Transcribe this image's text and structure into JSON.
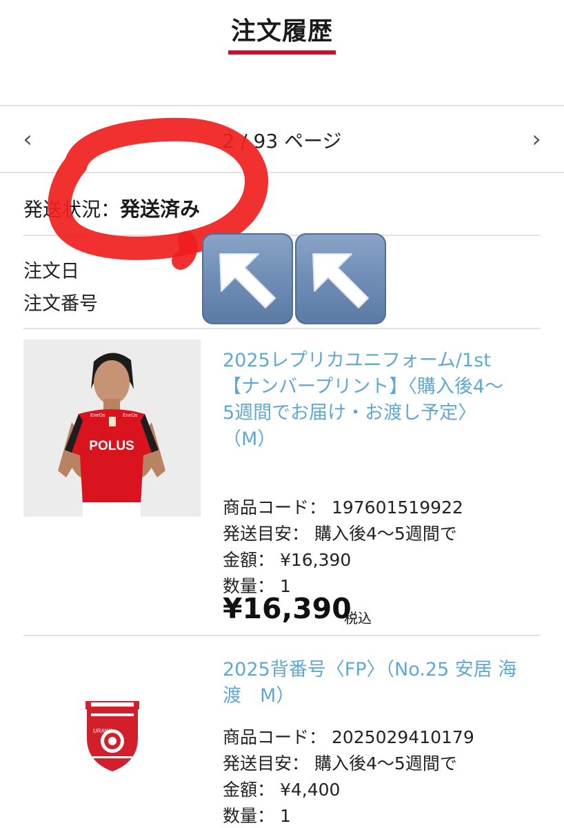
{
  "header": {
    "title": "注文履歴"
  },
  "pager": {
    "prev_icon": "chevron-left-icon",
    "text": "2 / 93 ページ",
    "next_icon": "chevron-right-icon"
  },
  "order": {
    "status_label": "発送状況：",
    "status_value": "発送済み",
    "date_label": "注文日",
    "number_label": "注文番号"
  },
  "overlay": {
    "emoji_arrows": [
      "up-left-arrow-icon",
      "up-left-arrow-icon"
    ],
    "highlight_color": "#f01e1e"
  },
  "items": [
    {
      "title_lines": [
        "2025レプリカユニフォーム/1st",
        "【ナンバープリント】〈購入後4〜",
        "5週間でお届け・お渡し予定〉",
        "（M）"
      ],
      "code": "商品コード： 197601519922",
      "shipping": "発送目安： 購入後4〜5週間で",
      "amount": "金額： ¥16,390",
      "quantity": "数量： 1",
      "total": "¥16,390",
      "tax": "税込",
      "image": "player-jersey-photo",
      "shirt_text": "POLUS",
      "shirt_sponsor": "EneOs"
    },
    {
      "title_lines": [
        "2025背番号〈FP〉（No.25 安居 海",
        "渡　M）"
      ],
      "code": "商品コード： 2025029410179",
      "shipping": "発送目安： 購入後4〜5週間で",
      "amount": "金額： ¥4,400",
      "quantity": "数量： 1",
      "image": "club-crest-logo",
      "crest_letters": "URAWA"
    }
  ],
  "colors": {
    "accent": "#c8102e",
    "link": "#5fa8d3",
    "divider": "#e2e2e2"
  }
}
